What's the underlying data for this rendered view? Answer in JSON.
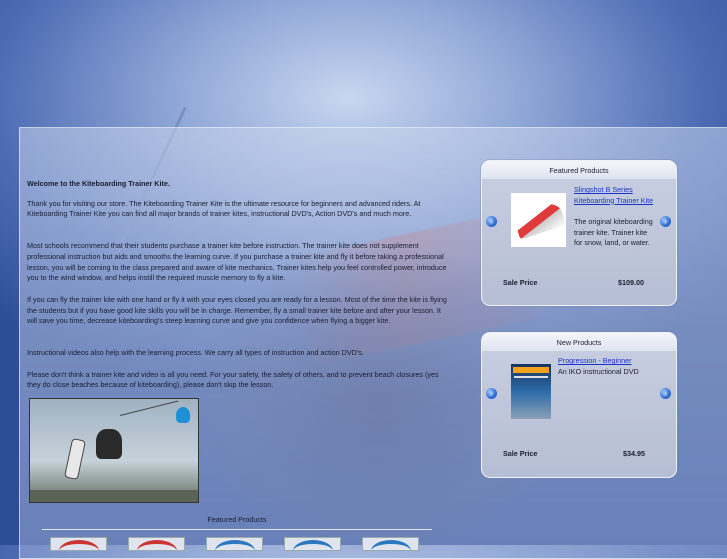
{
  "content": {
    "welcome": "Welcome to the Kiteboarding Trainer Kite.",
    "paragraphs": [
      "Thank you for visiting our store. The Kiteboarding Trainer Kite is the ultimate resource for beginners and advanced riders. At Kiteboarding Trainer Kite you can find all major brands of trainer kites, instructional DVD's, Action DVD's and much more.",
      "Most schools recommend that their students purchase a trainer kite before instruction. The trainer kite does not supplement professional instruction but aids and smooths the learning curve. If you purchase a trainer kite and fly it before taking a professional lesson, you will be coming to the class prepared and aware of kite mechanics. Trainer kites help you feel controlled power, introduce you to the wind window, and helps instill the required muscle memory to fly a kite.",
      "If you can fly the trainer kite with one hand or fly it with your eyes closed you are ready for a lesson. Most of the time the kite is flying the students but if you have good kite skills you will be in charge. Remember, fly a small trainer kite before and after your lesson. It will save you time, decrease kiteboarding's steep learning curve and give you confidence when flying a bigger kite.",
      "Instructional videos also help with the learning process. We carry all types of instruction and action DVD's.",
      "Please don't think a trainer kite and video is all you need. For your safety, the safety of others, and to prevent beach closures (yes they do close beaches because of kiteboarding), please don't skip the lesson."
    ]
  },
  "featured_bottom": {
    "title": "Featured Products"
  },
  "featured_box": {
    "title": "Featured Products",
    "product_link": "Slingshot B Series Kiteboarding Trainer Kite",
    "product_desc": "The original kiteboarding trainer kite. Trainer kite for snow, land, or water.",
    "sale_label": "Sale Price",
    "price": "$109.00",
    "prev_icon": "arrow-left-icon",
    "next_icon": "arrow-right-icon"
  },
  "new_box": {
    "title": "New Products",
    "product_link": "Progression - Beginner",
    "product_desc": "An IKO instructional DVD",
    "sale_label": "Sale Price",
    "price": "$34.95",
    "prev_icon": "arrow-left-icon",
    "next_icon": "arrow-right-icon"
  },
  "colors": {
    "link": "#1a33c8",
    "arrow": "#2f6ed1"
  }
}
